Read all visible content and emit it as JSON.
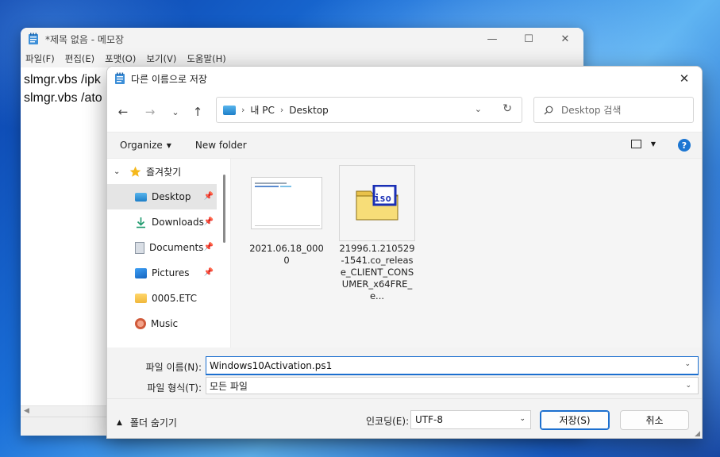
{
  "notepad": {
    "title": "*제목 없음 - 메모장",
    "menu": [
      "파일(F)",
      "편집(E)",
      "포맷(O)",
      "보기(V)",
      "도움말(H)"
    ],
    "lines": [
      "slmgr.vbs /ipk",
      "slmgr.vbs /ato"
    ],
    "controls": {
      "minimize": "—",
      "maximize": "☐",
      "close": "✕"
    }
  },
  "dialog": {
    "title": "다른 이름으로 저장",
    "close_glyph": "✕",
    "nav": {
      "back": "←",
      "forward": "→",
      "recent": "⌄",
      "up": "↑"
    },
    "breadcrumb": [
      "내 PC",
      "Desktop"
    ],
    "search_placeholder": "Desktop 검색",
    "toolbar": {
      "organize": "Organize",
      "new_folder": "New folder"
    },
    "sidebar": {
      "quick_access": "즐겨찾기",
      "items": [
        {
          "label": "Desktop",
          "icon": "desktop-icon",
          "pinned": true
        },
        {
          "label": "Downloads",
          "icon": "download-icon",
          "pinned": true
        },
        {
          "label": "Documents",
          "icon": "documents-icon",
          "pinned": true
        },
        {
          "label": "Pictures",
          "icon": "pictures-icon",
          "pinned": true
        },
        {
          "label": "0005.ETC",
          "icon": "folder-icon",
          "pinned": false
        },
        {
          "label": "Music",
          "icon": "music-icon",
          "pinned": false
        }
      ]
    },
    "files": [
      {
        "name": "2021.06.18_0000",
        "type": "screenshot"
      },
      {
        "name": "21996.1.210529-1541.co_release_CLIENT_CONSUMER_x64FRE_e...",
        "type": "iso"
      }
    ],
    "iso_badge": "iso",
    "filename_label": "파일 이름(N):",
    "filename_value": "Windows10Activation.ps1",
    "filetype_label": "파일 형식(T):",
    "filetype_value": "모든 파일",
    "hide_folders": "폴더 숨기기",
    "encoding_label": "인코딩(E):",
    "encoding_value": "UTF-8",
    "save_button": "저장(S)",
    "cancel_button": "취소"
  },
  "colors": {
    "accent": "#1c6fcf",
    "selected": "#e5e5e5",
    "pane": "#f3f3f3"
  }
}
